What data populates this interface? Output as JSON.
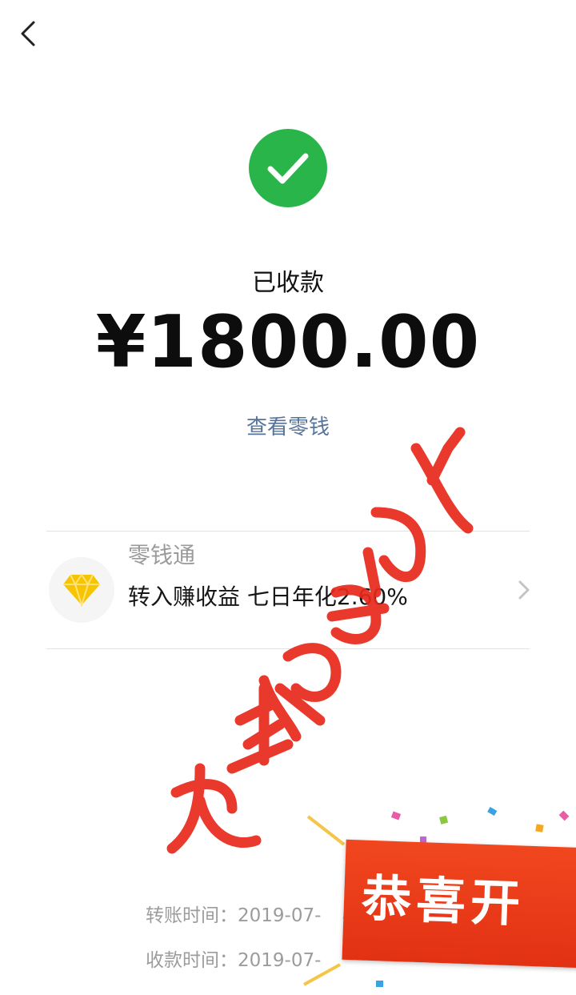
{
  "nav": {
    "back_icon": "chevron-left-icon"
  },
  "status": {
    "icon": "check-circle-icon",
    "label": "已收款"
  },
  "amount": "¥1800.00",
  "view_change_link": "查看零钱",
  "promo_card": {
    "icon": "diamond-icon",
    "title": "零钱通",
    "description": "转入赚收益 七日年化2.60%",
    "chevron_icon": "chevron-right-icon"
  },
  "times": {
    "transfer_label": "转账时间：2019-07-",
    "receive_label": "收款时间：2019-07-"
  },
  "overlays": {
    "watermark_text": "九千豪古包厂",
    "banner_text": "恭喜开"
  },
  "colors": {
    "success_green": "#29b54a",
    "link_blue": "#56739a",
    "diamond_yellow": "#f6c500",
    "watermark_red": "#e8291c",
    "banner_red": "#e53a1a"
  }
}
